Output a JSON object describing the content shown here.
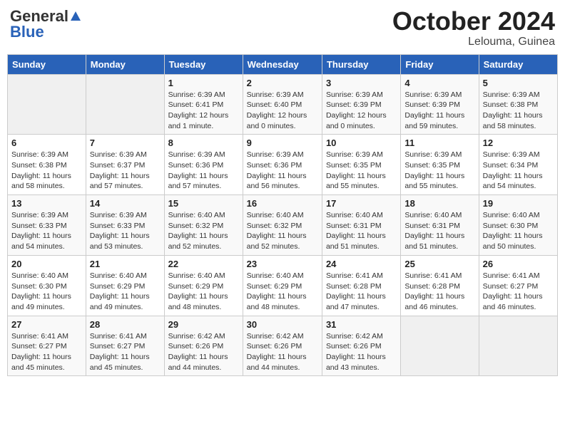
{
  "header": {
    "logo_general": "General",
    "logo_blue": "Blue",
    "month_title": "October 2024",
    "location": "Lelouma, Guinea"
  },
  "days_of_week": [
    "Sunday",
    "Monday",
    "Tuesday",
    "Wednesday",
    "Thursday",
    "Friday",
    "Saturday"
  ],
  "weeks": [
    [
      {
        "day": "",
        "sunrise": "",
        "sunset": "",
        "daylight": ""
      },
      {
        "day": "",
        "sunrise": "",
        "sunset": "",
        "daylight": ""
      },
      {
        "day": "1",
        "sunrise": "Sunrise: 6:39 AM",
        "sunset": "Sunset: 6:41 PM",
        "daylight": "Daylight: 12 hours and 1 minute."
      },
      {
        "day": "2",
        "sunrise": "Sunrise: 6:39 AM",
        "sunset": "Sunset: 6:40 PM",
        "daylight": "Daylight: 12 hours and 0 minutes."
      },
      {
        "day": "3",
        "sunrise": "Sunrise: 6:39 AM",
        "sunset": "Sunset: 6:39 PM",
        "daylight": "Daylight: 12 hours and 0 minutes."
      },
      {
        "day": "4",
        "sunrise": "Sunrise: 6:39 AM",
        "sunset": "Sunset: 6:39 PM",
        "daylight": "Daylight: 11 hours and 59 minutes."
      },
      {
        "day": "5",
        "sunrise": "Sunrise: 6:39 AM",
        "sunset": "Sunset: 6:38 PM",
        "daylight": "Daylight: 11 hours and 58 minutes."
      }
    ],
    [
      {
        "day": "6",
        "sunrise": "Sunrise: 6:39 AM",
        "sunset": "Sunset: 6:38 PM",
        "daylight": "Daylight: 11 hours and 58 minutes."
      },
      {
        "day": "7",
        "sunrise": "Sunrise: 6:39 AM",
        "sunset": "Sunset: 6:37 PM",
        "daylight": "Daylight: 11 hours and 57 minutes."
      },
      {
        "day": "8",
        "sunrise": "Sunrise: 6:39 AM",
        "sunset": "Sunset: 6:36 PM",
        "daylight": "Daylight: 11 hours and 57 minutes."
      },
      {
        "day": "9",
        "sunrise": "Sunrise: 6:39 AM",
        "sunset": "Sunset: 6:36 PM",
        "daylight": "Daylight: 11 hours and 56 minutes."
      },
      {
        "day": "10",
        "sunrise": "Sunrise: 6:39 AM",
        "sunset": "Sunset: 6:35 PM",
        "daylight": "Daylight: 11 hours and 55 minutes."
      },
      {
        "day": "11",
        "sunrise": "Sunrise: 6:39 AM",
        "sunset": "Sunset: 6:35 PM",
        "daylight": "Daylight: 11 hours and 55 minutes."
      },
      {
        "day": "12",
        "sunrise": "Sunrise: 6:39 AM",
        "sunset": "Sunset: 6:34 PM",
        "daylight": "Daylight: 11 hours and 54 minutes."
      }
    ],
    [
      {
        "day": "13",
        "sunrise": "Sunrise: 6:39 AM",
        "sunset": "Sunset: 6:33 PM",
        "daylight": "Daylight: 11 hours and 54 minutes."
      },
      {
        "day": "14",
        "sunrise": "Sunrise: 6:39 AM",
        "sunset": "Sunset: 6:33 PM",
        "daylight": "Daylight: 11 hours and 53 minutes."
      },
      {
        "day": "15",
        "sunrise": "Sunrise: 6:40 AM",
        "sunset": "Sunset: 6:32 PM",
        "daylight": "Daylight: 11 hours and 52 minutes."
      },
      {
        "day": "16",
        "sunrise": "Sunrise: 6:40 AM",
        "sunset": "Sunset: 6:32 PM",
        "daylight": "Daylight: 11 hours and 52 minutes."
      },
      {
        "day": "17",
        "sunrise": "Sunrise: 6:40 AM",
        "sunset": "Sunset: 6:31 PM",
        "daylight": "Daylight: 11 hours and 51 minutes."
      },
      {
        "day": "18",
        "sunrise": "Sunrise: 6:40 AM",
        "sunset": "Sunset: 6:31 PM",
        "daylight": "Daylight: 11 hours and 51 minutes."
      },
      {
        "day": "19",
        "sunrise": "Sunrise: 6:40 AM",
        "sunset": "Sunset: 6:30 PM",
        "daylight": "Daylight: 11 hours and 50 minutes."
      }
    ],
    [
      {
        "day": "20",
        "sunrise": "Sunrise: 6:40 AM",
        "sunset": "Sunset: 6:30 PM",
        "daylight": "Daylight: 11 hours and 49 minutes."
      },
      {
        "day": "21",
        "sunrise": "Sunrise: 6:40 AM",
        "sunset": "Sunset: 6:29 PM",
        "daylight": "Daylight: 11 hours and 49 minutes."
      },
      {
        "day": "22",
        "sunrise": "Sunrise: 6:40 AM",
        "sunset": "Sunset: 6:29 PM",
        "daylight": "Daylight: 11 hours and 48 minutes."
      },
      {
        "day": "23",
        "sunrise": "Sunrise: 6:40 AM",
        "sunset": "Sunset: 6:29 PM",
        "daylight": "Daylight: 11 hours and 48 minutes."
      },
      {
        "day": "24",
        "sunrise": "Sunrise: 6:41 AM",
        "sunset": "Sunset: 6:28 PM",
        "daylight": "Daylight: 11 hours and 47 minutes."
      },
      {
        "day": "25",
        "sunrise": "Sunrise: 6:41 AM",
        "sunset": "Sunset: 6:28 PM",
        "daylight": "Daylight: 11 hours and 46 minutes."
      },
      {
        "day": "26",
        "sunrise": "Sunrise: 6:41 AM",
        "sunset": "Sunset: 6:27 PM",
        "daylight": "Daylight: 11 hours and 46 minutes."
      }
    ],
    [
      {
        "day": "27",
        "sunrise": "Sunrise: 6:41 AM",
        "sunset": "Sunset: 6:27 PM",
        "daylight": "Daylight: 11 hours and 45 minutes."
      },
      {
        "day": "28",
        "sunrise": "Sunrise: 6:41 AM",
        "sunset": "Sunset: 6:27 PM",
        "daylight": "Daylight: 11 hours and 45 minutes."
      },
      {
        "day": "29",
        "sunrise": "Sunrise: 6:42 AM",
        "sunset": "Sunset: 6:26 PM",
        "daylight": "Daylight: 11 hours and 44 minutes."
      },
      {
        "day": "30",
        "sunrise": "Sunrise: 6:42 AM",
        "sunset": "Sunset: 6:26 PM",
        "daylight": "Daylight: 11 hours and 44 minutes."
      },
      {
        "day": "31",
        "sunrise": "Sunrise: 6:42 AM",
        "sunset": "Sunset: 6:26 PM",
        "daylight": "Daylight: 11 hours and 43 minutes."
      },
      {
        "day": "",
        "sunrise": "",
        "sunset": "",
        "daylight": ""
      },
      {
        "day": "",
        "sunrise": "",
        "sunset": "",
        "daylight": ""
      }
    ]
  ]
}
